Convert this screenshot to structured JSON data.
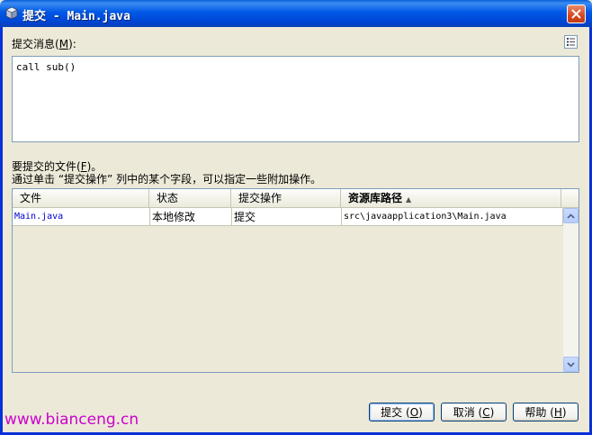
{
  "window": {
    "title": "提交 - Main.java",
    "icons": {
      "app": "cube-icon",
      "close": "close-icon"
    }
  },
  "commit_message": {
    "label": "提交消息",
    "mnemonic": "M",
    "label_tail": "):",
    "value": "call sub()",
    "template_icon": "list-icon"
  },
  "files": {
    "label": "要提交的文件",
    "mnemonic": "F",
    "label_tail": ")。",
    "hint": "通过单击 “提交操作” 列中的某个字段，可以指定一些附加操作。",
    "columns": [
      "文件",
      "状态",
      "提交操作",
      "资源库路径"
    ],
    "sort_indicator": "▲",
    "rows": [
      {
        "file": "Main.java",
        "status": "本地修改",
        "action": "提交",
        "path": "src\\javaapplication3\\Main.java"
      }
    ]
  },
  "buttons": {
    "commit": {
      "label": "提交",
      "mnemonic": "O"
    },
    "cancel": {
      "label": "取消",
      "mnemonic": "C"
    },
    "help": {
      "label": "帮助",
      "mnemonic": "H"
    }
  },
  "watermark": "www.bianceng.cn",
  "colors": {
    "titlebar": "#0058e6",
    "dialog_bg": "#ece9d8",
    "close_button": "#d8471f",
    "file_link": "#0000cc",
    "watermark": "#cc00cc"
  }
}
